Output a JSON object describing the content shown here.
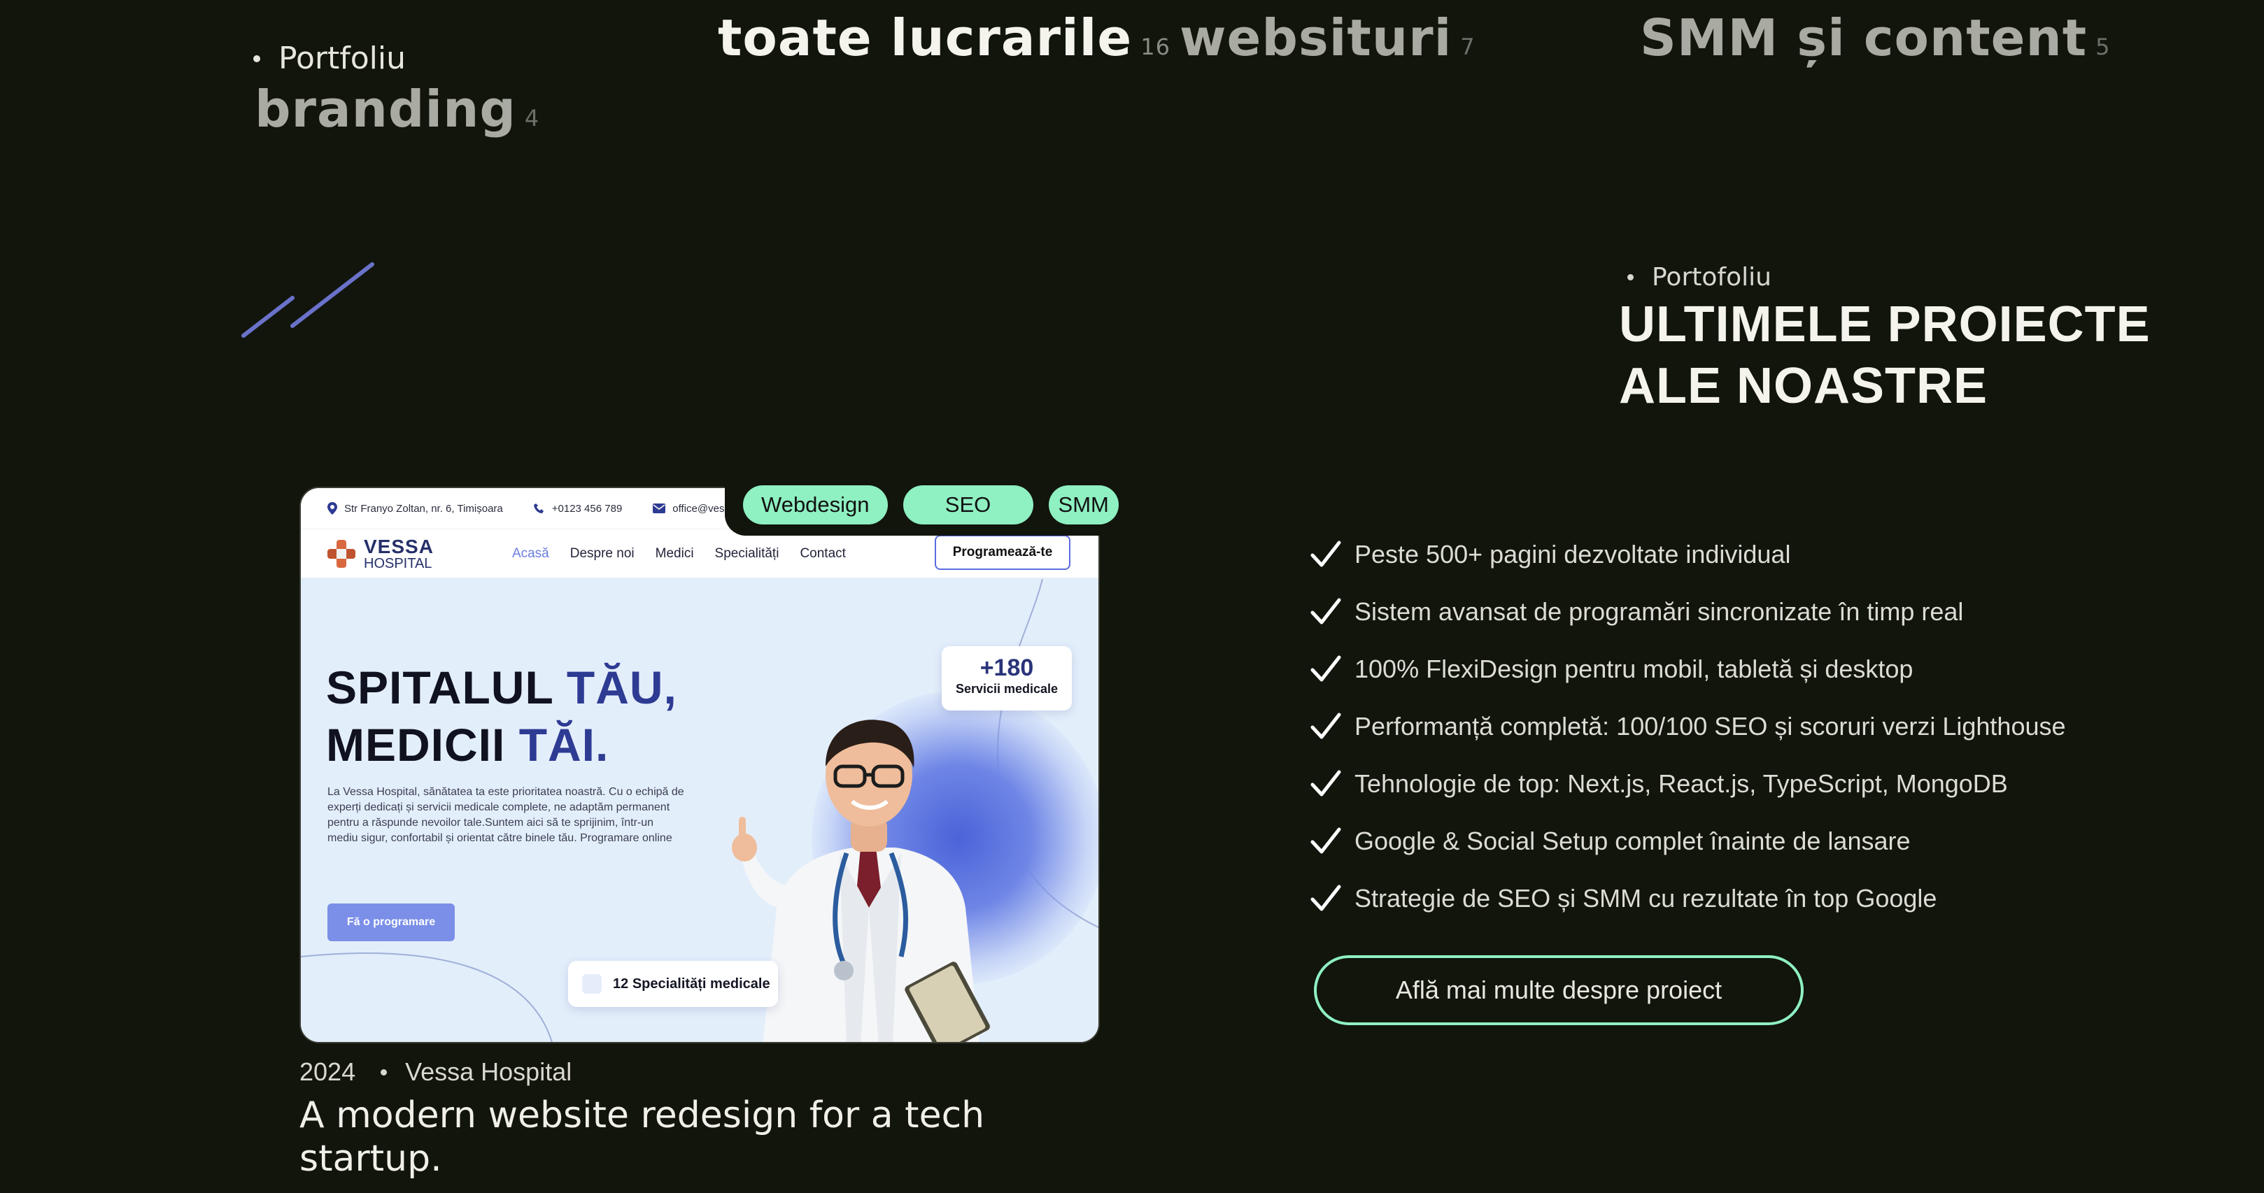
{
  "filters": {
    "section_label": "Portfoliu",
    "items": [
      {
        "label": "toate lucrarile",
        "count": "16"
      },
      {
        "label": "websituri",
        "count": "7"
      },
      {
        "label": "SMM și content",
        "count": "5"
      },
      {
        "label": "branding",
        "count": "4"
      }
    ]
  },
  "section": {
    "label": "Portofoliu",
    "title_line1": "ULTIMELE PROIECTE",
    "title_line2": "ALE NOASTRE"
  },
  "project": {
    "tags": [
      "Webdesign",
      "SEO",
      "SMM"
    ],
    "preview": {
      "address": "Str Franyo Zoltan, nr. 6, Timișoara",
      "phone": "+0123 456 789",
      "email": "office@vessa",
      "logo_line1": "VESSA",
      "logo_line2": "HOSPITAL",
      "nav": [
        "Acasă",
        "Despre noi",
        "Medici",
        "Specialități",
        "Contact"
      ],
      "cta": "Programează-te",
      "hero_line1_a": "SPITALUL ",
      "hero_line1_b": "TĂU,",
      "hero_line2_a": "MEDICII ",
      "hero_line2_b": "TĂI.",
      "hero_body": "La Vessa Hospital, sănătatea ta este prioritatea noastră. Cu o echipă de experți dedicați și servicii medicale complete, ne adaptăm permanent pentru a răspunde nevoilor tale.Suntem aici să te sprijinim, într-un mediu sigur, confortabil și orientat către binele tău. Programare online",
      "hero_button": "Fă o programare",
      "stats_number": "+180",
      "stats_label": "Servicii medicale",
      "specialties_number": "12",
      "specialties_label": "Specialități medicale"
    },
    "year": "2024",
    "client": "Vessa Hospital",
    "description": "A modern website redesign for a tech startup."
  },
  "features": [
    "Peste 500+ pagini dezvoltate individual",
    "Sistem avansat de programări sincronizate în timp real",
    "100% FlexiDesign pentru mobil, tabletă și desktop",
    "Performanță completă: 100/100 SEO și scoruri verzi Lighthouse",
    "Tehnologie de top: Next.js, React.js, TypeScript, MongoDB",
    "Google & Social Setup complet înainte de lansare",
    "Strategie de SEO și SMM cu rezultate în top Google"
  ],
  "more_button": "Află mai multe despre proiect",
  "colors": {
    "background": "#11150c",
    "accent_mint": "#8ff0c2",
    "slash_blue": "#6a72c9",
    "hospital_navy": "#2e3b93"
  }
}
